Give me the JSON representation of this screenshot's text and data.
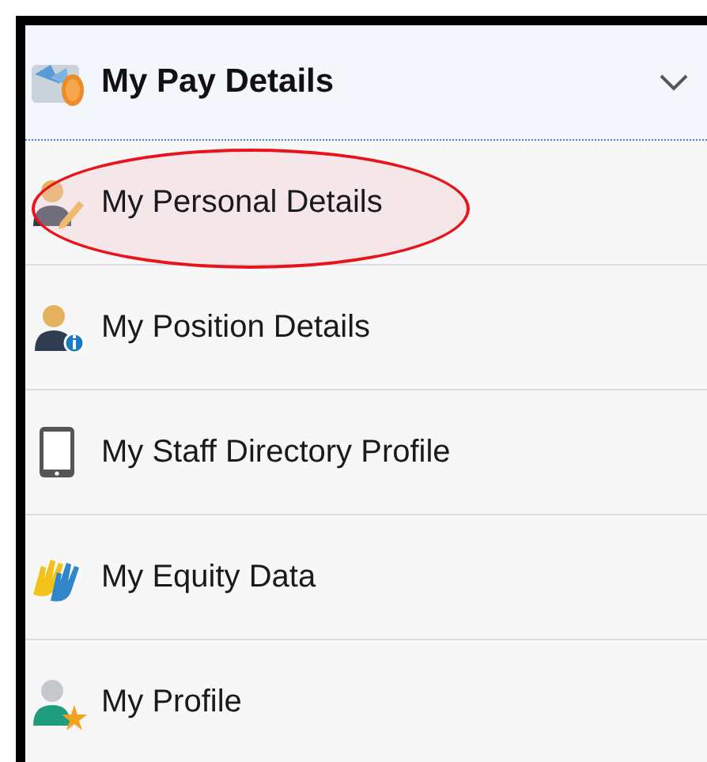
{
  "header": {
    "title": "My Pay Details",
    "expanded": true
  },
  "items": [
    {
      "label": "My Personal Details",
      "circled": true
    },
    {
      "label": "My Position Details",
      "circled": false
    },
    {
      "label": "My Staff Directory Profile",
      "circled": false
    },
    {
      "label": "My Equity Data",
      "circled": false
    },
    {
      "label": "My Profile",
      "circled": false
    }
  ]
}
